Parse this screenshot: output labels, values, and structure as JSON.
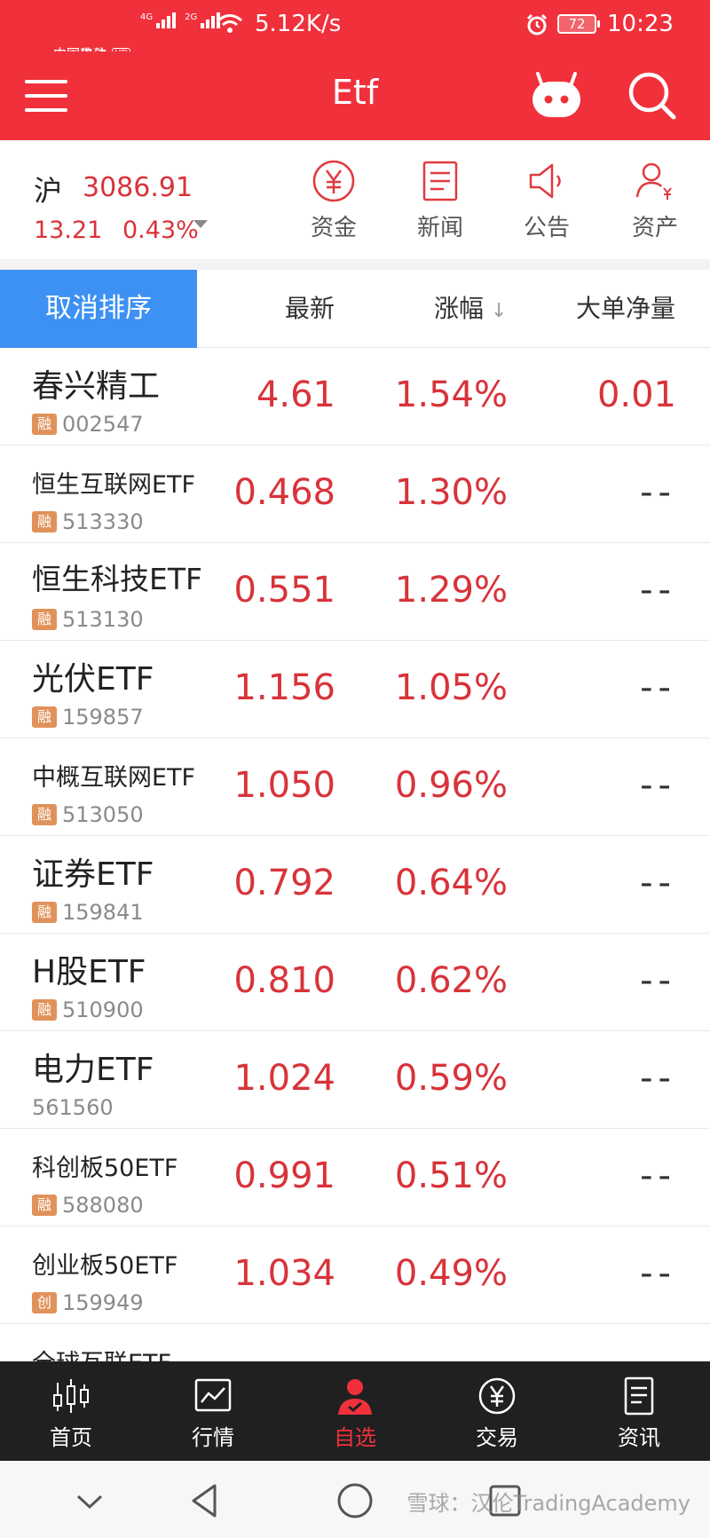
{
  "status_bar": {
    "carrier_1": "中国电信",
    "hd": "HD",
    "carrier_2": "中国移动",
    "net_1": "4G",
    "net_2": "2G",
    "speed": "5.12K/s",
    "battery": "72",
    "time": "10:23"
  },
  "header": {
    "title": "Etf",
    "icons": [
      "menu-icon",
      "robot-icon",
      "search-icon"
    ]
  },
  "index": {
    "name": "沪",
    "value": "3086.91",
    "change": "13.21",
    "change_pct": "0.43%"
  },
  "shortcuts": [
    {
      "label": "资金",
      "icon": "yuan-circle-icon"
    },
    {
      "label": "新闻",
      "icon": "news-icon"
    },
    {
      "label": "公告",
      "icon": "speaker-icon"
    },
    {
      "label": "资产",
      "icon": "user-yuan-icon"
    }
  ],
  "table": {
    "cancel_sort": "取消排序",
    "col_latest": "最新",
    "col_change": "涨幅",
    "col_volume": "大单净量",
    "sort_arrow": "↓"
  },
  "rows": [
    {
      "name": "春兴精工",
      "tag": "融",
      "code": "002547",
      "price": "4.61",
      "pct": "1.54%",
      "vol": "0.01"
    },
    {
      "name": "恒生互联网ETF",
      "tag": "融",
      "code": "513330",
      "price": "0.468",
      "pct": "1.30%",
      "vol": "--"
    },
    {
      "name": "恒生科技ETF",
      "tag": "融",
      "code": "513130",
      "price": "0.551",
      "pct": "1.29%",
      "vol": "--"
    },
    {
      "name": "光伏ETF",
      "tag": "融",
      "code": "159857",
      "price": "1.156",
      "pct": "1.05%",
      "vol": "--"
    },
    {
      "name": "中概互联网ETF",
      "tag": "融",
      "code": "513050",
      "price": "1.050",
      "pct": "0.96%",
      "vol": "--"
    },
    {
      "name": "证券ETF",
      "tag": "融",
      "code": "159841",
      "price": "0.792",
      "pct": "0.64%",
      "vol": "--"
    },
    {
      "name": "H股ETF",
      "tag": "融",
      "code": "510900",
      "price": "0.810",
      "pct": "0.62%",
      "vol": "--"
    },
    {
      "name": "电力ETF",
      "tag": "",
      "code": "561560",
      "price": "1.024",
      "pct": "0.59%",
      "vol": "--"
    },
    {
      "name": "科创板50ETF",
      "tag": "融",
      "code": "588080",
      "price": "0.991",
      "pct": "0.51%",
      "vol": "--"
    },
    {
      "name": "创业板50ETF",
      "tag": "创",
      "code": "159949",
      "price": "1.034",
      "pct": "0.49%",
      "vol": "--"
    },
    {
      "name": "全球互联ETF",
      "tag": "",
      "code": "",
      "price": "",
      "pct": "",
      "vol": ""
    }
  ],
  "bottom_nav": [
    {
      "label": "首页",
      "icon": "candlestick-icon"
    },
    {
      "label": "行情",
      "icon": "chart-icon"
    },
    {
      "label": "自选",
      "icon": "user-check-icon",
      "active": true
    },
    {
      "label": "交易",
      "icon": "yuan-circle-icon"
    },
    {
      "label": "资讯",
      "icon": "document-icon"
    }
  ],
  "system_nav": {
    "icons": [
      "collapse-chevron-icon",
      "back-triangle-icon",
      "home-circle-icon",
      "recents-square-icon"
    ],
    "watermark": "雪球：汉伦TradingAcademy"
  },
  "colors": {
    "brand_red": "#f0313c",
    "up_red": "#d8333a",
    "sort_blue": "#3d91f2",
    "tag_orange": "#e0925a",
    "nav_dark": "#202020"
  }
}
